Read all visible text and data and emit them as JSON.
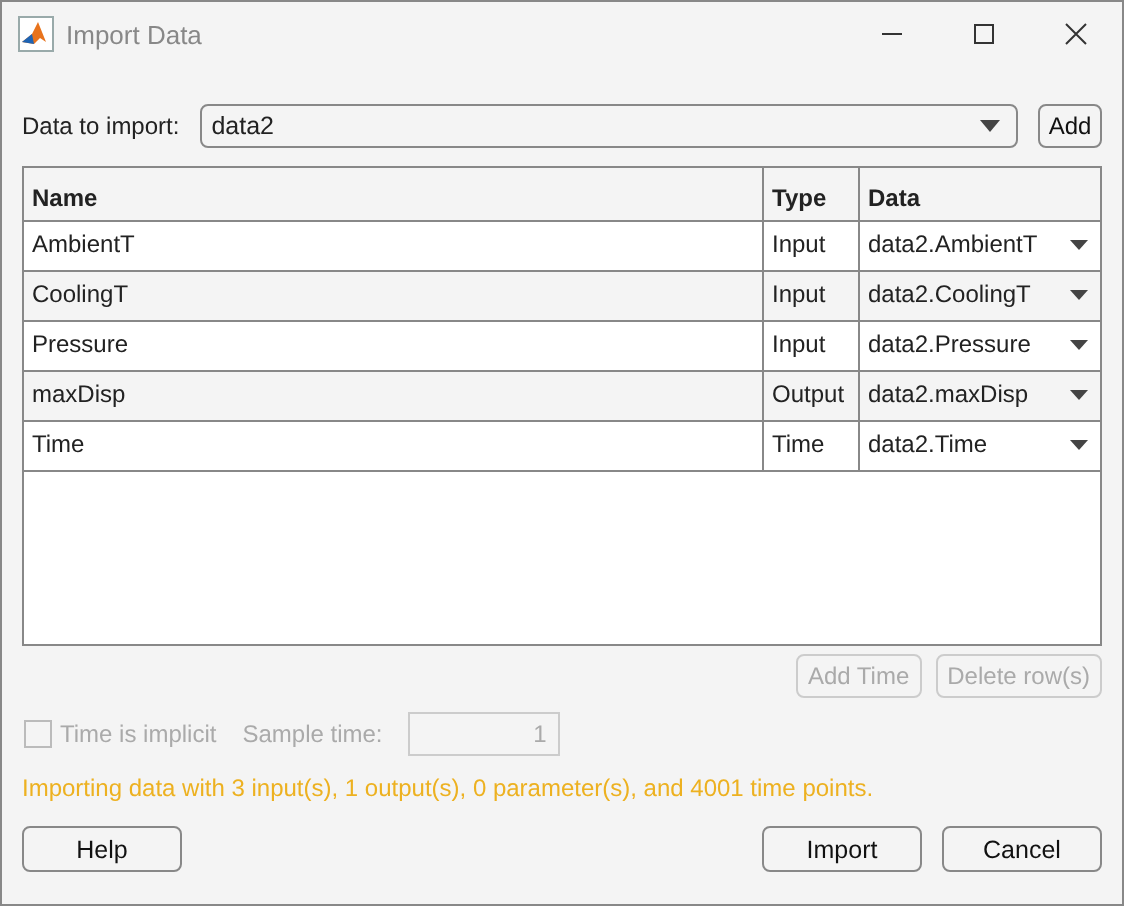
{
  "window": {
    "title": "Import Data"
  },
  "data_to_import": {
    "label": "Data to import:",
    "value": "data2"
  },
  "add_button": {
    "label": "Add",
    "disabled": false
  },
  "table": {
    "columns": [
      "Name",
      "Type",
      "Data"
    ],
    "rows": [
      {
        "name": "AmbientT",
        "type": "Input",
        "data": "data2.AmbientT"
      },
      {
        "name": "CoolingT",
        "type": "Input",
        "data": "data2.CoolingT"
      },
      {
        "name": "Pressure",
        "type": "Input",
        "data": "data2.Pressure"
      },
      {
        "name": "maxDisp",
        "type": "Output",
        "data": "data2.maxDisp"
      },
      {
        "name": "Time",
        "type": "Time",
        "data": "data2.Time"
      }
    ]
  },
  "table_buttons": [
    {
      "label": "Add Time",
      "disabled": true
    },
    {
      "label": "Delete row(s)",
      "disabled": true
    }
  ],
  "time_is_implicit": {
    "label": "Time is implicit",
    "checked": false,
    "disabled": true
  },
  "sample_time": {
    "label": "Sample time:",
    "value": "1",
    "disabled": true
  },
  "message": "Importing data with 3 input(s), 1 output(s), 0 parameter(s), and 4001 time points.",
  "footer_buttons": [
    {
      "label": "Help",
      "disabled": false
    },
    {
      "label": "Import",
      "disabled": false
    },
    {
      "label": "Cancel",
      "disabled": false
    }
  ]
}
